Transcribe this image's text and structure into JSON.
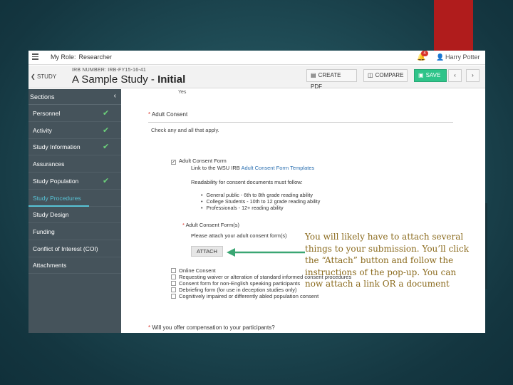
{
  "topbar": {
    "menu_icon": "hamburger-icon",
    "role_label": "My Role:",
    "role_value": "Researcher",
    "notification_count": "4",
    "user_name": "Harry Potter"
  },
  "header": {
    "back_label": "STUDY",
    "irb_number": "IRB NUMBER: IRB-FY15-16-41",
    "title_prefix": "A Sample Study - ",
    "title_bold": "Initial",
    "create_pdf_label": "CREATE PDF",
    "compare_label": "COMPARE",
    "save_label": "SAVE",
    "prev_icon": "‹",
    "next_icon": "›"
  },
  "sidebar": {
    "heading": "Sections",
    "items": [
      {
        "label": "Personnel",
        "complete": true
      },
      {
        "label": "Activity",
        "complete": true
      },
      {
        "label": "Study Information",
        "complete": true
      },
      {
        "label": "Assurances",
        "complete": false
      },
      {
        "label": "Study Population",
        "complete": true
      },
      {
        "label": "Study Procedures",
        "complete": false
      },
      {
        "label": "Study Design",
        "complete": false
      },
      {
        "label": "Funding",
        "complete": false
      },
      {
        "label": "Conflict of Interest (COI)",
        "complete": false
      },
      {
        "label": "Attachments",
        "complete": false
      }
    ],
    "active_item": "Study Procedures"
  },
  "main": {
    "partial_top": "Yes",
    "section_title": "Adult Consent",
    "check_note": "Check any and all that apply.",
    "adult_form_label": "Adult Consent Form",
    "link_line_prefix": "Link to the WSU IRB ",
    "link_line_link": "Adult Consent Form Templates",
    "readability_note": "Readability for consent documents must follow:",
    "bullets": [
      "General public - 6th to 8th grade reading ability",
      "College Students - 10th to 12 grade reading ability",
      "Professionals - 12+ reading ability"
    ],
    "consent_forms_label": "Adult Consent Form(s)",
    "attach_prompt": "Please attach your adult consent form(s)",
    "attach_button": "ATTACH",
    "options": [
      "Online Consent",
      "Requesting waiver or alteration of standard informed consent procedures",
      "Consent form for non-English speaking participants",
      "Debriefing form (for use in deception studies only)",
      "Cognitively impaired or differently abled population consent"
    ],
    "bottom_question": "Will you offer compensation to your participants?"
  },
  "callout": {
    "text": "You will likely have to attach several things to your submission.  You’ll click the “Attach” button and follow the instructions of the pop-up. You can now attach a link OR a document"
  },
  "colors": {
    "sidebar_bg": "#45535b",
    "save_green": "#2fc48a",
    "check_green": "#6cd07a",
    "active_blue": "#58c3d6",
    "callout_text": "#8b6b1e",
    "arrow_green": "#3aa673",
    "red_bar": "#b01c1c"
  }
}
